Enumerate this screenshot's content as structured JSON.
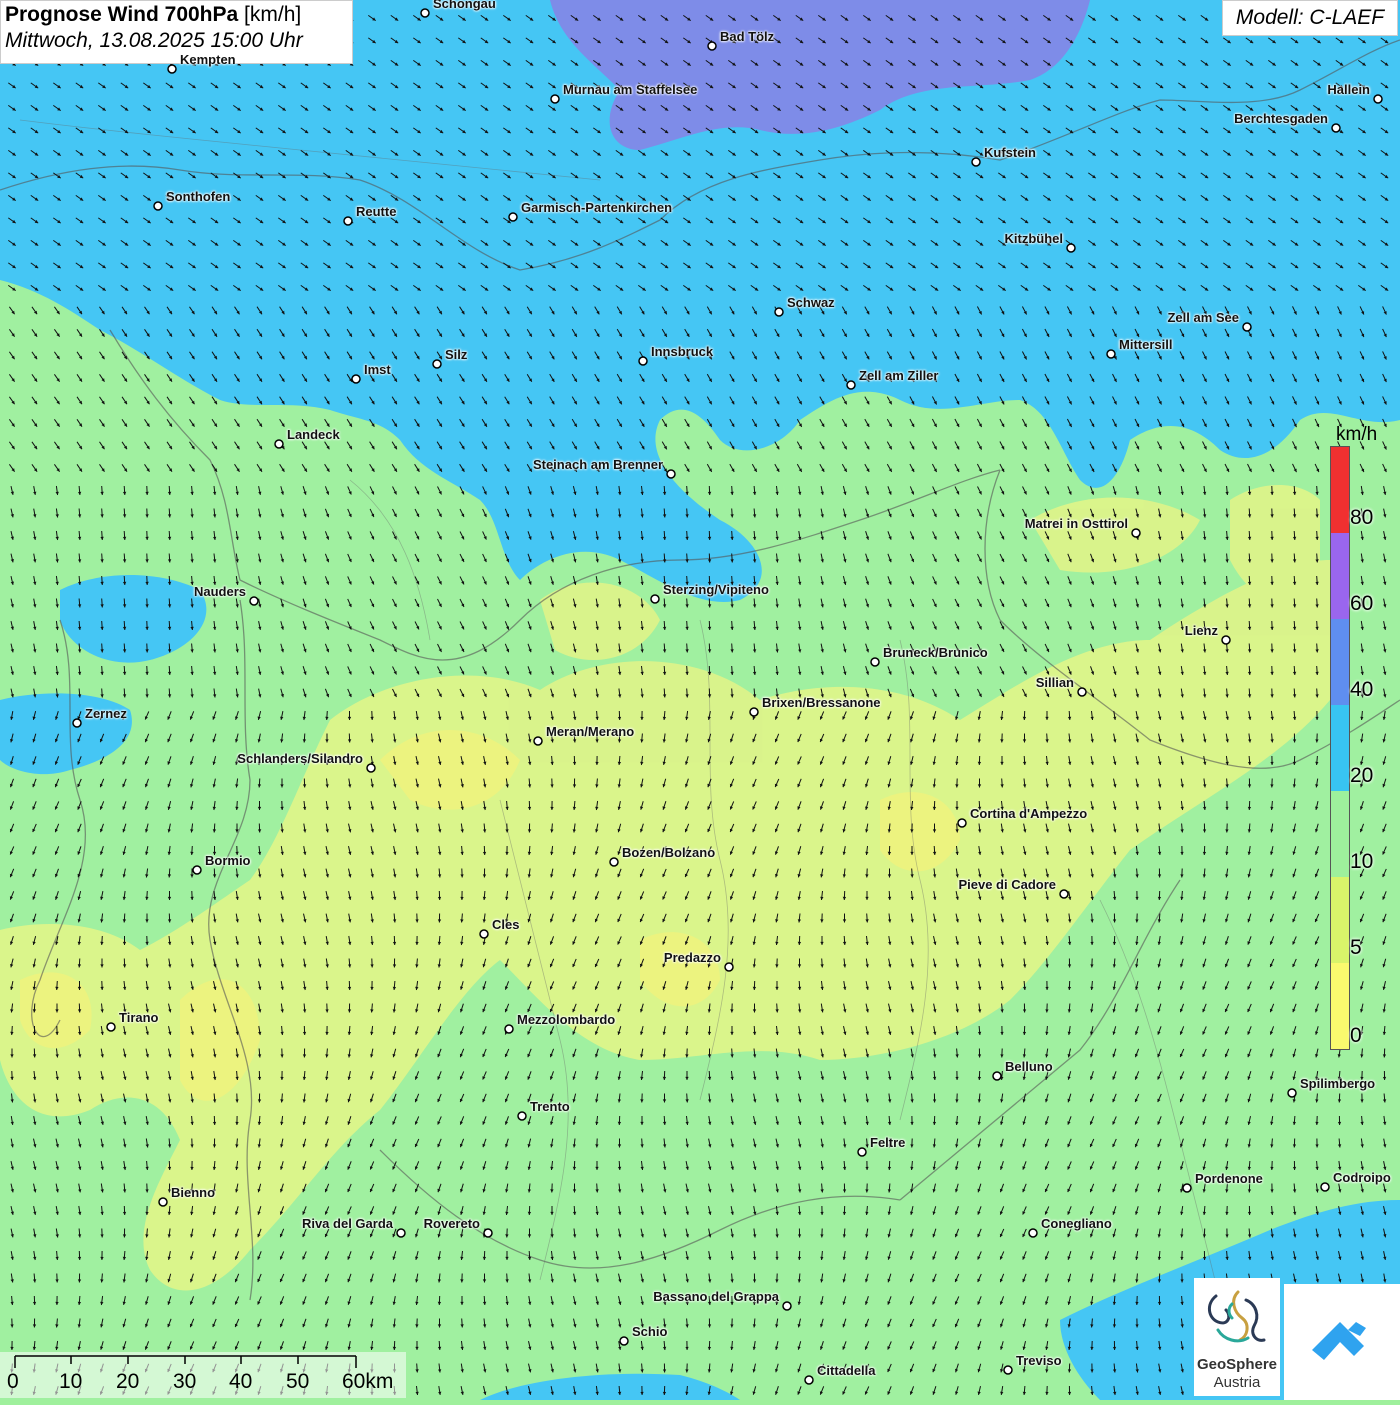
{
  "header": {
    "title_bold": "Prognose Wind 700hPa",
    "title_unit": "[km/h]",
    "datetime": "Mittwoch, 13.08.2025 15:00 Uhr",
    "model": "Modell: C-LAEF"
  },
  "legend": {
    "unit": "km/h",
    "labels": [
      "80",
      "60",
      "40",
      "20",
      "10",
      "5",
      "0"
    ],
    "colors": [
      "#f03030",
      "#9a66ee",
      "#5f8ef0",
      "#38c4f2",
      "#9ef09c",
      "#d9f46a",
      "#fafa6e"
    ]
  },
  "scale": {
    "labels": [
      "0",
      "10",
      "20",
      "30",
      "40",
      "50",
      "60km"
    ]
  },
  "logo": {
    "line1": "GeoSphere",
    "line2": "Austria"
  },
  "colors": {
    "calm_yellow": "#f2f57a",
    "light_green": "#9ff09c",
    "cyan": "#45c6f4",
    "violet": "#7b8ae8"
  },
  "cities": [
    {
      "name": "Schongau"
    },
    {
      "name": "Bad Tölz"
    },
    {
      "name": "Kempten"
    },
    {
      "name": "Murnau am Staffelsee"
    },
    {
      "name": "Hallein"
    },
    {
      "name": "Berchtesgaden"
    },
    {
      "name": "Kufstein"
    },
    {
      "name": "Sonthofen"
    },
    {
      "name": "Reutte"
    },
    {
      "name": "Garmisch-Partenkirchen"
    },
    {
      "name": "Kitzbühel"
    },
    {
      "name": "Schwaz"
    },
    {
      "name": "Zell am See"
    },
    {
      "name": "Mittersill"
    },
    {
      "name": "Innsbruck"
    },
    {
      "name": "Silz"
    },
    {
      "name": "Imst"
    },
    {
      "name": "Zell am Ziller"
    },
    {
      "name": "Landeck"
    },
    {
      "name": "Steinach am Brenner"
    },
    {
      "name": "Matrei in Osttirol"
    },
    {
      "name": "Nauders"
    },
    {
      "name": "Sterzing/Vipiteno"
    },
    {
      "name": "Lienz"
    },
    {
      "name": "Bruneck/Brunico"
    },
    {
      "name": "Sillian"
    },
    {
      "name": "Brixen/Bressanone"
    },
    {
      "name": "Zernez"
    },
    {
      "name": "Meran/Merano"
    },
    {
      "name": "Schlanders/Silandro"
    },
    {
      "name": "Cortina d'Ampezzo"
    },
    {
      "name": "Bozen/Bolzano"
    },
    {
      "name": "Bormio"
    },
    {
      "name": "Pieve di Cadore"
    },
    {
      "name": "Cles"
    },
    {
      "name": "Predazzo"
    },
    {
      "name": "Tirano"
    },
    {
      "name": "Mezzolombardo"
    },
    {
      "name": "Belluno"
    },
    {
      "name": "Spilimbergo"
    },
    {
      "name": "Trento"
    },
    {
      "name": "Feltre"
    },
    {
      "name": "Pordenone"
    },
    {
      "name": "Codroipo"
    },
    {
      "name": "Bienno"
    },
    {
      "name": "Riva del Garda"
    },
    {
      "name": "Rovereto"
    },
    {
      "name": "Conegliano"
    },
    {
      "name": "Bassano del Grappa"
    },
    {
      "name": "Schio"
    },
    {
      "name": "Treviso"
    },
    {
      "name": "Cittadella"
    }
  ]
}
